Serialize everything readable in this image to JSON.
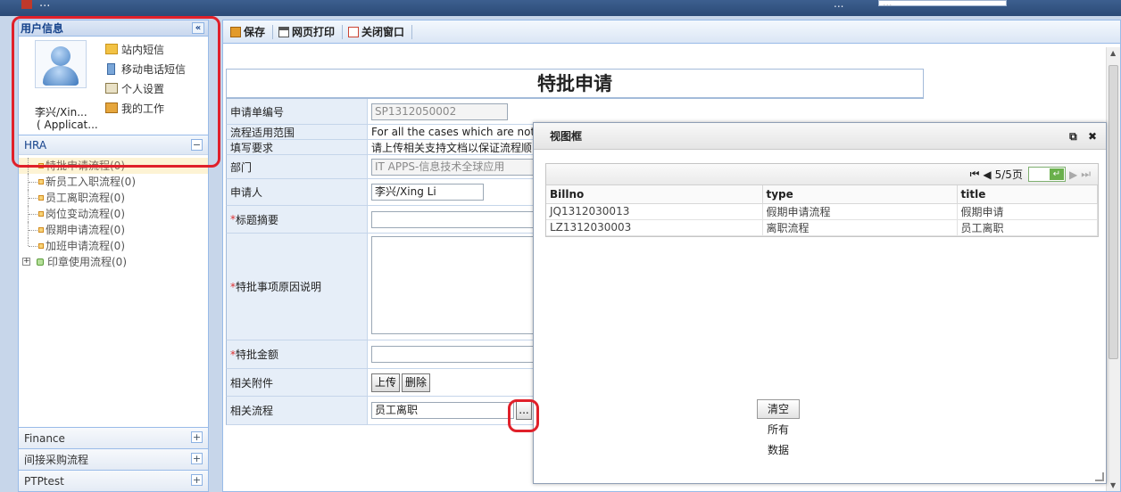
{
  "topbar": {
    "app_name": "...",
    "user_label": "...",
    "user_value": "..."
  },
  "sidebar": {
    "user_panel_title": "用户信息",
    "user_name": "李兴/Xin...",
    "user_role": "( Applicat...",
    "links": [
      "站内短信",
      "移动电话短信",
      "个人设置",
      "我的工作"
    ],
    "section_title": "HRA",
    "tree_items": [
      "特批申请流程(0)",
      "新员工入职流程(0)",
      "员工离职流程(0)",
      "岗位变动流程(0)",
      "假期申请流程(0)",
      "加班申请流程(0)"
    ],
    "tree_group": "印章使用流程(0)",
    "bottom_sections": [
      "Finance",
      "间接采购流程",
      "PTPtest"
    ]
  },
  "toolbar": {
    "save_label": "保存",
    "print_label": "网页打印",
    "close_label": "关闭窗口"
  },
  "form": {
    "title": "特批申请",
    "rows": {
      "number_label": "申请单编号",
      "number_value": "SP1312050002",
      "scope_label": "流程适用范围",
      "scope_value": "For all the cases which are not co",
      "requirement_label": "填写要求",
      "requirement_value": "请上传相关支持文档以保证流程顺",
      "dept_label": "部门",
      "dept_value": "IT APPS-信息技术全球应用",
      "applicant_label": "申请人",
      "applicant_value": "李兴/Xing Li",
      "summary_label": "标题摘要",
      "reason_label": "特批事项原因说明",
      "amount_label": "特批金额",
      "attach_label": "相关附件",
      "upload_btn": "上传",
      "delete_btn": "删除",
      "related_label": "相关流程",
      "related_value": "员工离职",
      "browse_btn": "..."
    }
  },
  "dialog": {
    "title": "视图框",
    "pager_text": "5/5页",
    "columns": [
      "Billno",
      "type",
      "title"
    ],
    "rows": [
      [
        "JQ1312030013",
        "假期申请流程",
        "假期申请"
      ],
      [
        "LZ1312030003",
        "离职流程",
        "员工离职"
      ]
    ],
    "clear_btn": "清空",
    "text1": "所有",
    "text2": "数据"
  },
  "colors": {
    "highlight": "#e0202a",
    "panel_border": "#99bbe8",
    "header_text": "#15428b"
  }
}
